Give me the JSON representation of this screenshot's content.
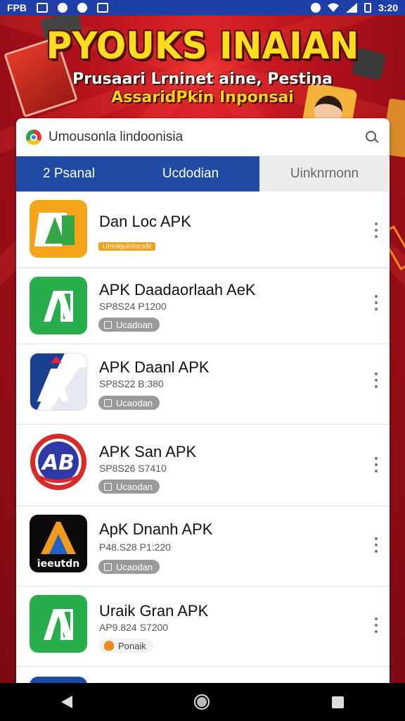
{
  "status_bar": {
    "left_label": "FPB",
    "time": "3:20",
    "icons": [
      "image-icon",
      "circle-icon",
      "circle-icon",
      "mail-icon",
      "location-icon",
      "wifi-icon",
      "signal-icon",
      "battery-icon"
    ]
  },
  "banner": {
    "headline": "PYOUKS INAIAN",
    "line1": "Prusaari Lrninet aine, Pestina",
    "line2": "AssaridPkin Inponsai"
  },
  "search": {
    "text": "Umousonla lindoonisia"
  },
  "tabs": [
    {
      "label": "2 Psanal"
    },
    {
      "label": "Ucdodian"
    },
    {
      "label": "Uinknrnonn"
    }
  ],
  "apps": [
    {
      "name": "Dan Loc APK",
      "meta": "",
      "pill": "Umolquinlnrudit",
      "pill_style": "orange",
      "icon": "document-a-icon"
    },
    {
      "name": "APK Daadaorlaah AeK",
      "meta": "SP8S24 P1200",
      "pill": "Ucadoan",
      "pill_style": "gray",
      "icon": "document-a-icon"
    },
    {
      "name": "APK Daanl APK",
      "meta": "SP8S22 B:380",
      "pill": "Ucaodan",
      "pill_style": "gray",
      "icon": "ap-logo-icon"
    },
    {
      "name": "APK San APK",
      "meta": "SP8S26 S7410",
      "pill": "Ucaodan",
      "pill_style": "gray",
      "icon": "ab-logo-icon"
    },
    {
      "name": "ApK Dnanh APK",
      "meta": "P48.S28 P1:220",
      "pill": "Ucaodan",
      "pill_style": "gray",
      "icon": "a-logo-icon"
    },
    {
      "name": "Uraik Gran APK",
      "meta": "AP9.824 S7200",
      "pill": "Ponaik",
      "pill_style": "light",
      "icon": "document-a-icon"
    }
  ],
  "colors": {
    "primary": "#1f4ba5",
    "banner_red": "#b5121b",
    "headline_yellow": "#ffdc1e"
  }
}
